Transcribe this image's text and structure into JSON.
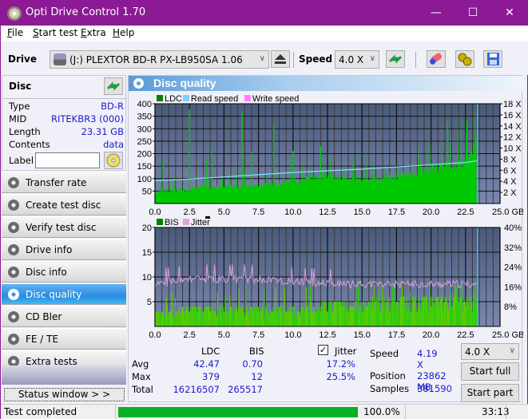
{
  "window": {
    "title": "Opti Drive Control 1.70",
    "minimize": "—",
    "maximize": "☐",
    "close": "✕"
  },
  "menu": [
    {
      "label": "File",
      "u": "F",
      "rest": "ile"
    },
    {
      "label": "Start test",
      "u": "S",
      "rest": "tart test"
    },
    {
      "label": "Extra",
      "u": "E",
      "pre": "",
      "rest": "xtra"
    },
    {
      "label": "Help",
      "u": "H",
      "rest": "elp"
    }
  ],
  "toolbar": {
    "drive_label": "Drive",
    "drive_value": "(J:)  PLEXTOR BD-R  PX-LB950SA 1.06",
    "speed_label": "Speed",
    "speed_value": "4.0 X",
    "icons": [
      "eject-icon",
      "refresh-icon",
      "eraser-icon",
      "settings-icon",
      "save-icon"
    ]
  },
  "disc": {
    "header": "Disc",
    "fields": [
      {
        "key": "Type",
        "value": "BD-R"
      },
      {
        "key": "MID",
        "value": "RITEKBR3 (000)"
      },
      {
        "key": "Length",
        "value": "23.31 GB"
      },
      {
        "key": "Contents",
        "value": "data"
      }
    ],
    "label_key": "Label",
    "label_value": ""
  },
  "nav": [
    {
      "label": "Transfer rate",
      "active": false
    },
    {
      "label": "Create test disc",
      "active": false
    },
    {
      "label": "Verify test disc",
      "active": false
    },
    {
      "label": "Drive info",
      "active": false
    },
    {
      "label": "Disc info",
      "active": false
    },
    {
      "label": "Disc quality",
      "active": true
    },
    {
      "label": "CD Bler",
      "active": false
    },
    {
      "label": "FE / TE",
      "active": false
    },
    {
      "label": "Extra tests",
      "active": false
    }
  ],
  "status_window_label": "Status window > >",
  "panel": {
    "title": "Disc quality"
  },
  "chart_data": [
    {
      "type": "area",
      "title": "",
      "legend": [
        "LDC",
        "Read speed",
        "Write speed"
      ],
      "legend_colors": [
        "#008000",
        "#80d0ff",
        "#ff80ff"
      ],
      "legend_position": "top-left",
      "xlabel": "GB",
      "x_ticks": [
        "0.0",
        "2.5",
        "5.0",
        "7.5",
        "10.0",
        "12.5",
        "15.0",
        "17.5",
        "20.0",
        "22.5",
        "25.0 GB"
      ],
      "xlim": [
        0,
        25
      ],
      "y_ticks": [
        "50",
        "100",
        "150",
        "200",
        "250",
        "300",
        "350",
        "400"
      ],
      "ylim": [
        0,
        400
      ],
      "y2_ticks": [
        "2 X",
        "4 X",
        "6 X",
        "8 X",
        "10 X",
        "12 X",
        "14 X",
        "16 X",
        "18 X"
      ],
      "y2lim": [
        0,
        18
      ],
      "grid": true,
      "end_marker_gb": 23.31,
      "ldc_baseline": [
        [
          0,
          50
        ],
        [
          2.5,
          65
        ],
        [
          5,
          75
        ],
        [
          7.5,
          80
        ],
        [
          10,
          95
        ],
        [
          12.5,
          120
        ],
        [
          15,
          100
        ],
        [
          17.5,
          115
        ],
        [
          20,
          150
        ],
        [
          22.5,
          180
        ],
        [
          23.31,
          250
        ]
      ],
      "ldc_spikes": [
        [
          0.6,
          180
        ],
        [
          2.5,
          379
        ],
        [
          3.7,
          180
        ],
        [
          4.1,
          220
        ],
        [
          6.3,
          370
        ],
        [
          7.0,
          205
        ],
        [
          8.6,
          320
        ],
        [
          10.0,
          210
        ],
        [
          12.0,
          230
        ],
        [
          14.4,
          190
        ],
        [
          21.2,
          330
        ],
        [
          22.6,
          335
        ]
      ],
      "read_speed": [
        [
          0,
          4.1
        ],
        [
          2.5,
          4.4
        ],
        [
          5,
          4.8
        ],
        [
          7.5,
          5.2
        ],
        [
          10,
          5.6
        ],
        [
          12.5,
          5.9
        ],
        [
          15,
          6.2
        ],
        [
          17.5,
          6.6
        ],
        [
          20,
          7.0
        ],
        [
          22.5,
          7.4
        ],
        [
          23.31,
          7.7
        ]
      ]
    },
    {
      "type": "area",
      "title": "",
      "legend": [
        "BIS",
        "Jitter"
      ],
      "legend_colors": [
        "#008000",
        "#e0a0e0"
      ],
      "legend_position": "top-left",
      "xlabel": "GB",
      "x_ticks": [
        "0.0",
        "2.5",
        "5.0",
        "7.5",
        "10.0",
        "12.5",
        "15.0",
        "17.5",
        "20.0",
        "22.5",
        "25.0 GB"
      ],
      "xlim": [
        0,
        25
      ],
      "y_ticks": [
        "5",
        "10",
        "15",
        "20"
      ],
      "ylim": [
        0,
        20
      ],
      "y2_ticks": [
        "8%",
        "16%",
        "24%",
        "32%",
        "40%"
      ],
      "y2lim": [
        0,
        40
      ],
      "grid": true,
      "end_marker_gb": 23.31,
      "bis_level": [
        [
          0,
          3
        ],
        [
          2.5,
          4
        ],
        [
          5,
          4
        ],
        [
          7.5,
          4
        ],
        [
          10,
          4
        ],
        [
          12.5,
          5
        ],
        [
          15,
          5
        ],
        [
          17.5,
          6
        ],
        [
          20,
          6
        ],
        [
          22.5,
          6
        ],
        [
          23.31,
          7
        ]
      ],
      "bis_max": 12,
      "jitter_pct": [
        [
          0,
          17
        ],
        [
          2.5,
          19
        ],
        [
          5,
          19
        ],
        [
          7.5,
          19
        ],
        [
          10,
          18
        ],
        [
          12.5,
          17
        ],
        [
          15,
          17
        ],
        [
          17.5,
          17
        ],
        [
          20,
          17
        ],
        [
          22.5,
          17
        ],
        [
          23.31,
          17
        ]
      ],
      "jitter_peak_pct": 25.5
    }
  ],
  "stats": {
    "col_ldc": "LDC",
    "col_bis": "BIS",
    "jitter_label": "Jitter",
    "jitter_checked": true,
    "rows": [
      {
        "label": "Avg",
        "ldc": "42.47",
        "bis": "0.70",
        "jitter": "17.2%"
      },
      {
        "label": "Max",
        "ldc": "379",
        "bis": "12",
        "jitter": "25.5%"
      },
      {
        "label": "Total",
        "ldc": "16216507",
        "bis": "265517",
        "jitter": ""
      }
    ],
    "speed_label": "Speed",
    "speed_value": "4.19 X",
    "position_label": "Position",
    "position_value": "23862 MB",
    "samples_label": "Samples",
    "samples_value": "381590",
    "speed_select": "4.0 X",
    "start_full": "Start full",
    "start_part": "Start part"
  },
  "statusbar": {
    "text": "Test completed",
    "progress_pct": 100.0,
    "progress_text": "100.0%",
    "elapsed": "33:13"
  }
}
